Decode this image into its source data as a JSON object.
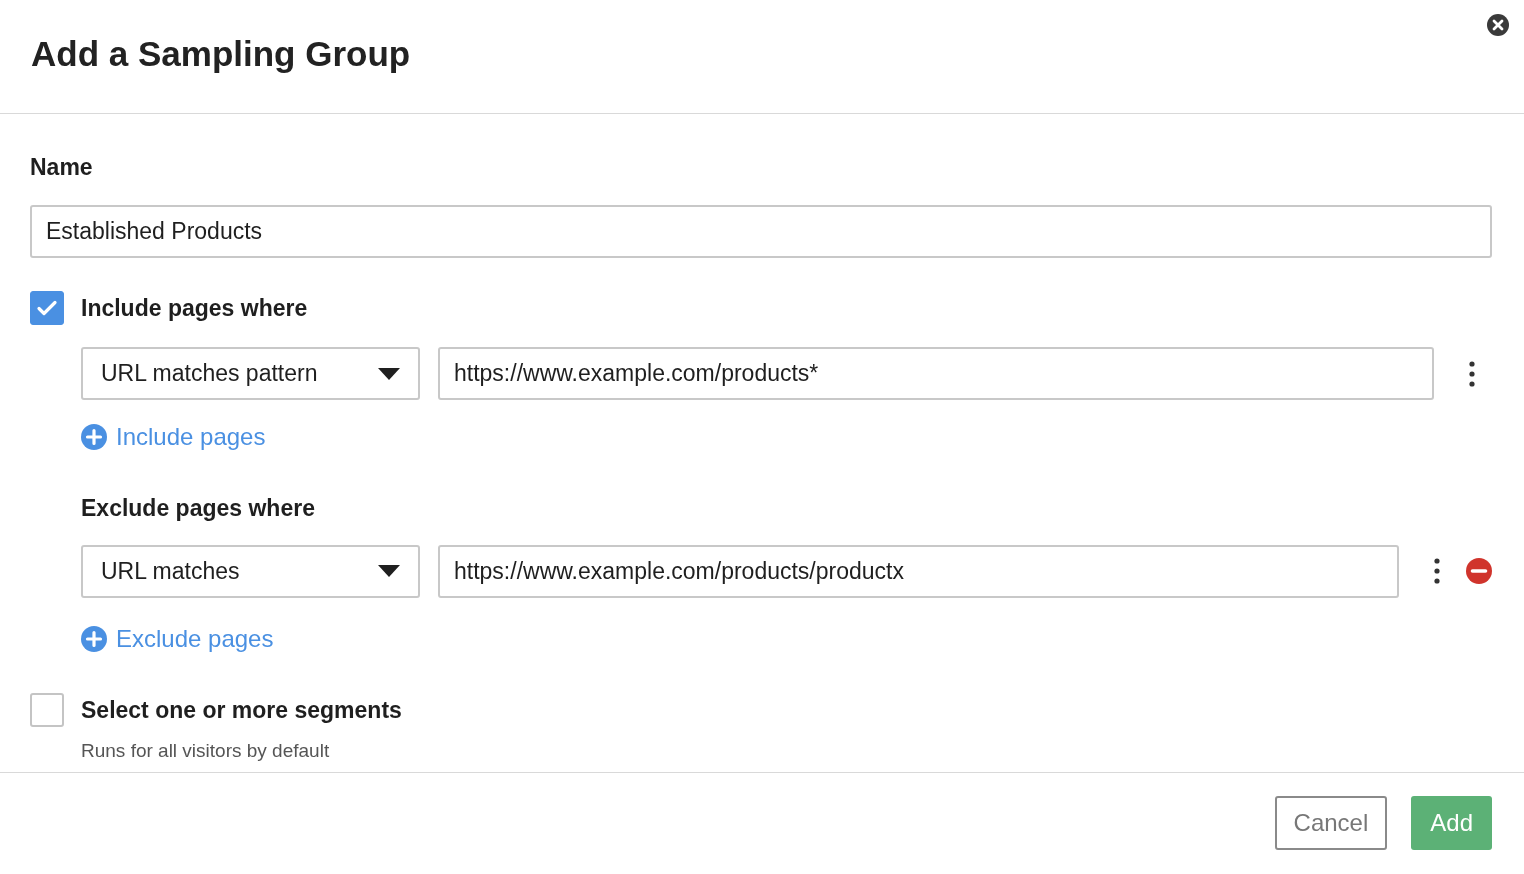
{
  "dialog": {
    "title": "Add a Sampling Group"
  },
  "name_field": {
    "label": "Name",
    "value": "Established Products"
  },
  "include": {
    "checked": true,
    "label": "Include pages where",
    "rules": [
      {
        "operator": "URL matches pattern",
        "value": "https://www.example.com/products*",
        "removable": false
      }
    ],
    "add_link": "Include pages"
  },
  "exclude": {
    "label": "Exclude pages where",
    "rules": [
      {
        "operator": "URL matches",
        "value": "https://www.example.com/products/productx",
        "removable": true
      }
    ],
    "add_link": "Exclude pages"
  },
  "segments": {
    "checked": false,
    "label": "Select one or more segments",
    "hint": "Runs for all visitors by default"
  },
  "buttons": {
    "cancel": "Cancel",
    "add": "Add"
  }
}
